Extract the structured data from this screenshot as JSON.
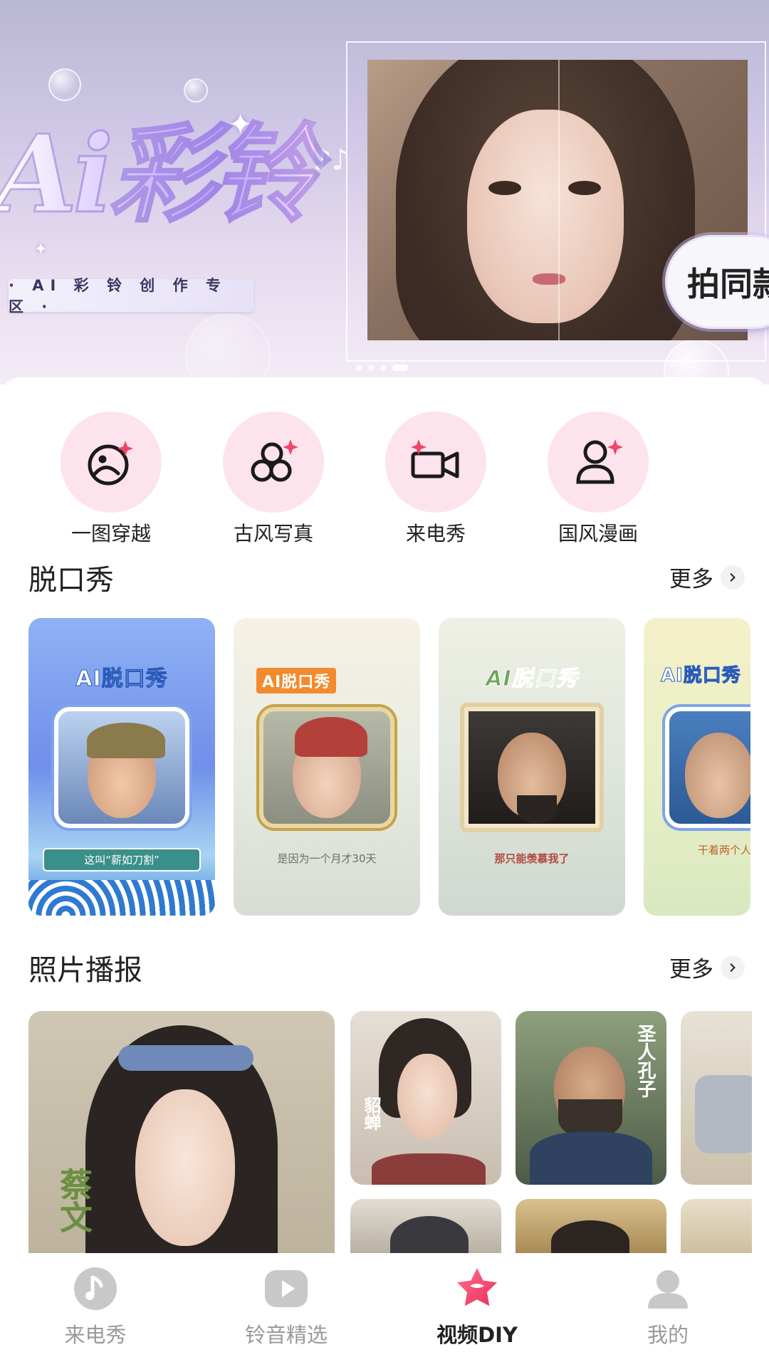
{
  "banner": {
    "title": "Ai彩铃",
    "subtitle": "· AI 彩 铃 创 作 专 区 ·",
    "cta_label": "拍同款",
    "page_dots": 4,
    "active_dot": 3
  },
  "categories": [
    {
      "label": "一图穿越",
      "icon": "face-sparkle-icon"
    },
    {
      "label": "古风写真",
      "icon": "circles-sparkle-icon"
    },
    {
      "label": "来电秀",
      "icon": "video-camera-sparkle-icon"
    },
    {
      "label": "国风漫画",
      "icon": "person-sparkle-icon"
    }
  ],
  "sections": {
    "talk_show": {
      "title": "脱口秀",
      "more": "更多"
    },
    "photo_news": {
      "title": "照片播报",
      "more": "更多"
    }
  },
  "talk_show_cards": [
    {
      "badge": "AI脱口秀",
      "caption": "这叫“薪如刀割”"
    },
    {
      "badge": "AI脱口秀",
      "caption": "是因为一个月才30天"
    },
    {
      "badge": "AI脱口秀",
      "caption": "那只能羡慕我了"
    },
    {
      "badge": "AI脱口秀",
      "caption": "干着两个人"
    }
  ],
  "photo_news_cards": [
    {
      "label": "蔡文"
    },
    {
      "label": "貂蝉"
    },
    {
      "label": "圣人孔子"
    },
    {
      "label": ""
    }
  ],
  "bottom_nav": [
    {
      "label": "来电秀",
      "icon": "music-note-icon",
      "active": false
    },
    {
      "label": "铃音精选",
      "icon": "play-icon",
      "active": false
    },
    {
      "label": "视频DIY",
      "icon": "star-icon",
      "active": true
    },
    {
      "label": "我的",
      "icon": "profile-icon",
      "active": false
    }
  ],
  "colors": {
    "accent_pink": "#fde3ec",
    "active_nav": "#f0446a",
    "inactive_nav": "#c8c8c8"
  }
}
